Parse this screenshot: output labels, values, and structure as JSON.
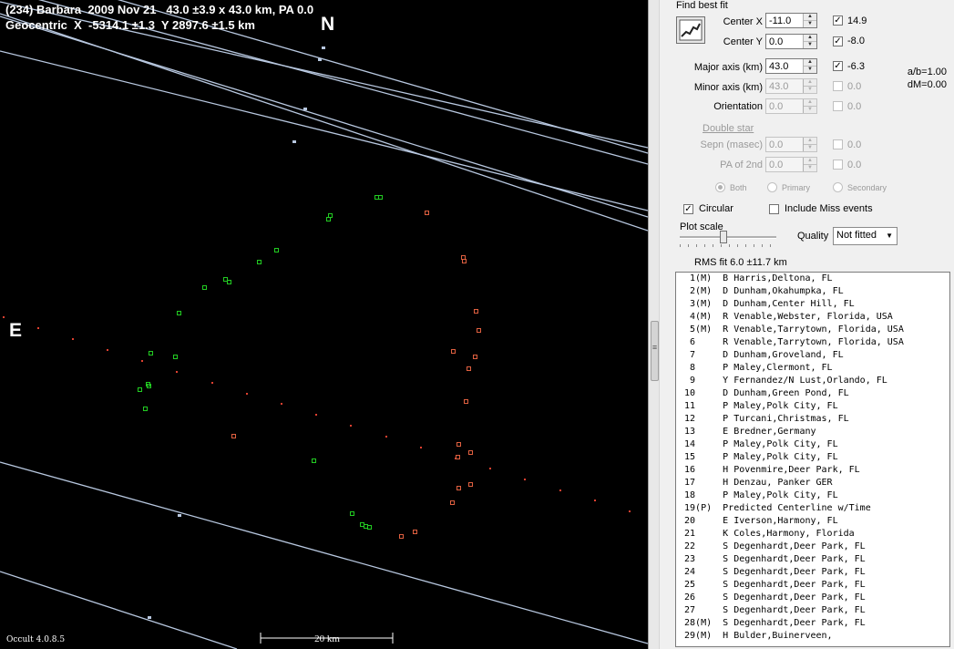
{
  "plot": {
    "title_line1": "(234) Barbara  2009 Nov 21   43.0 ±3.9 x 43.0 km, PA 0.0",
    "title_line2": "Geocentric  X  -5314.1 ±1.3  Y 2897.6 ±1.5 km",
    "north": "N",
    "east": "E",
    "version": "Occult 4.0.8.5",
    "scale_label": "20 km",
    "colors": {
      "background": "#000000",
      "chord_line": "#b8c8e0",
      "disappear": "#22cc22",
      "reappear": "#e06040",
      "predicted": "#e04030"
    }
  },
  "panel": {
    "find_best_fit": "Find best fit",
    "center_x": {
      "label": "Center X",
      "value": "-11.0",
      "checked": true,
      "result": "14.9"
    },
    "center_y": {
      "label": "Center Y",
      "value": "0.0",
      "checked": true,
      "result": "-8.0"
    },
    "major_axis": {
      "label": "Major axis (km)",
      "value": "43.0",
      "checked": true,
      "result": "-6.3"
    },
    "minor_axis": {
      "label": "Minor axis (km)",
      "value": "43.0",
      "checked": false,
      "result": "0.0"
    },
    "orientation": {
      "label": "Orientation",
      "value": "0.0",
      "checked": false,
      "result": "0.0"
    },
    "ab_ratio": "a/b=1.00",
    "dm": "dM=0.00",
    "double_star": "Double star",
    "sepn": {
      "label": "Sepn (masec)",
      "value": "0.0",
      "checked": false,
      "result": "0.0"
    },
    "pa2": {
      "label": "PA of 2nd",
      "value": "0.0",
      "checked": false,
      "result": "0.0"
    },
    "radio_both": "Both",
    "radio_primary": "Primary",
    "radio_secondary": "Secondary",
    "circular_label": "Circular",
    "circular_checked": true,
    "include_miss_label": "Include Miss events",
    "include_miss_checked": false,
    "plot_scale_label": "Plot scale",
    "quality_label": "Quality",
    "quality_value": "Not fitted",
    "rms_fit": "RMS fit 6.0 ±11.7 km"
  },
  "observers": [
    "  1(M)  B Harris,Deltona, FL",
    "  2(M)  D Dunham,Okahumpka, FL",
    "  3(M)  D Dunham,Center Hill, FL",
    "  4(M)  R Venable,Webster, Florida, USA",
    "  5(M)  R Venable,Tarrytown, Florida, USA",
    "  6     R Venable,Tarrytown, Florida, USA",
    "  7     D Dunham,Groveland, FL",
    "  8     P Maley,Clermont, FL",
    "  9     Y Fernandez/N Lust,Orlando, FL",
    " 10     D Dunham,Green Pond, FL",
    " 11     P Maley,Polk City, FL",
    " 12     P Turcani,Christmas, FL",
    " 13     E Bredner,Germany",
    " 14     P Maley,Polk City, FL",
    " 15     P Maley,Polk City, FL",
    " 16     H Povenmire,Deer Park, FL",
    " 17     H Denzau, Panker GER",
    " 18     P Maley,Polk City, FL",
    " 19(P)  Predicted Centerline w/Time",
    " 20     E Iverson,Harmony, FL",
    " 21     K Coles,Harmony, Florida",
    " 22     S Degenhardt,Deer Park, FL",
    " 23     S Degenhardt,Deer Park, FL",
    " 24     S Degenhardt,Deer Park, FL",
    " 25     S Degenhardt,Deer Park, FL",
    " 26     S Degenhardt,Deer Park, FL",
    " 27     S Degenhardt,Deer Park, FL",
    " 28(M)  S Degenhardt,Deer Park, FL",
    " 29(M)  H Bulder,Buinerveen,"
  ]
}
